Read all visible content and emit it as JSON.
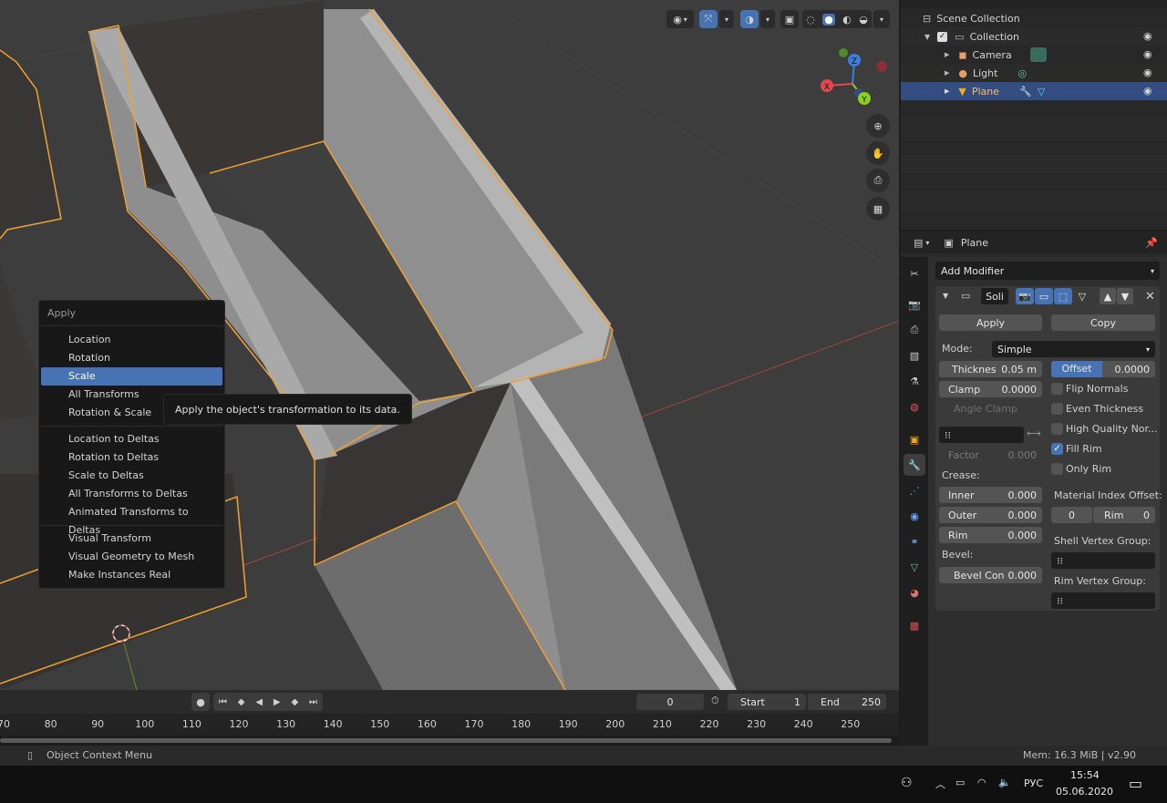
{
  "context_menu": {
    "title": "Apply",
    "groups": [
      [
        "Location",
        "Rotation",
        "Scale",
        "All Transforms",
        "Rotation & Scale"
      ],
      [
        "Location to Deltas",
        "Rotation to Deltas",
        "Scale to Deltas",
        "All Transforms to Deltas",
        "Animated Transforms to Deltas"
      ],
      [
        "Visual Transform",
        "Visual Geometry to Mesh",
        "Make Instances Real"
      ]
    ],
    "hovered": "Scale",
    "tooltip": "Apply the object's transformation to its data."
  },
  "viewport": {
    "gizmo": {
      "x_label": "X",
      "y_label": "Y",
      "z_label": "Z"
    },
    "icons": [
      "eye-icon",
      "transform-icon",
      "overlay-icon",
      "xray-icon",
      "wireframe-icon",
      "solid-icon",
      "material-icon",
      "rendered-icon"
    ],
    "navigation": [
      "zoom-icon",
      "pan-icon",
      "camera-icon",
      "ortho-grid-icon"
    ]
  },
  "outliner": {
    "rows": [
      {
        "label": "Scene Collection",
        "icon": "scene-collection-icon",
        "indent": 0
      },
      {
        "label": "Collection",
        "icon": "collection-icon",
        "indent": 1
      },
      {
        "label": "Camera",
        "icon": "camera-object-icon",
        "indent": 2
      },
      {
        "label": "Light",
        "icon": "light-object-icon",
        "indent": 2
      },
      {
        "label": "Plane",
        "icon": "mesh-object-icon",
        "indent": 2,
        "selected": true
      }
    ]
  },
  "properties": {
    "object_name": "Plane",
    "add_modifier": "Add Modifier",
    "modifier_name": "Soli",
    "apply": "Apply",
    "copy": "Copy",
    "mode_label": "Mode:",
    "mode_value": "Simple",
    "thickness_label": "Thicknes",
    "thickness_value": "0.05 m",
    "offset_label": "Offset",
    "offset_value": "0.0000",
    "clamp_label": "Clamp",
    "clamp_value": "0.0000",
    "angle_clamp": "Angle Clamp",
    "flip_normals": "Flip Normals",
    "even_thickness": "Even Thickness",
    "high_quality": "High Quality Nor...",
    "fill_rim": "Fill Rim",
    "only_rim": "Only Rim",
    "factor_label": "Factor",
    "factor_value": "0.000",
    "crease_label": "Crease:",
    "inner_label": "Inner",
    "inner_value": "0.000",
    "outer_label": "Outer",
    "outer_value": "0.000",
    "rim_label": "Rim",
    "rim_value": "0.000",
    "material_offset_label": "Material Index Offset:",
    "mat_offset_value": "0",
    "mat_rim_label": "Rim",
    "mat_rim_value": "0",
    "bevel_label": "Bevel:",
    "bevel_con_label": "Bevel Con",
    "bevel_con_value": "0.000",
    "shell_vgroup_label": "Shell Vertex Group:",
    "rim_vgroup_label": "Rim Vertex Group:"
  },
  "timeline": {
    "current_frame": "0",
    "start_label": "Start",
    "start_value": "1",
    "end_label": "End",
    "end_value": "250",
    "ticks": [
      "70",
      "80",
      "90",
      "100",
      "110",
      "120",
      "130",
      "140",
      "150",
      "160",
      "170",
      "180",
      "190",
      "200",
      "210",
      "220",
      "230",
      "240",
      "250"
    ]
  },
  "statusbar": {
    "left": "Object Context Menu",
    "right": "Mem: 16.3 MiB | v2.90"
  },
  "taskbar": {
    "language": "РУС",
    "time": "15:54",
    "date": "05.06.2020"
  },
  "colors": {
    "accent": "#4772b3",
    "selection_outline": "#f5a623",
    "menu_bg": "#181818",
    "viewport_bg": "#3d3d3d"
  }
}
